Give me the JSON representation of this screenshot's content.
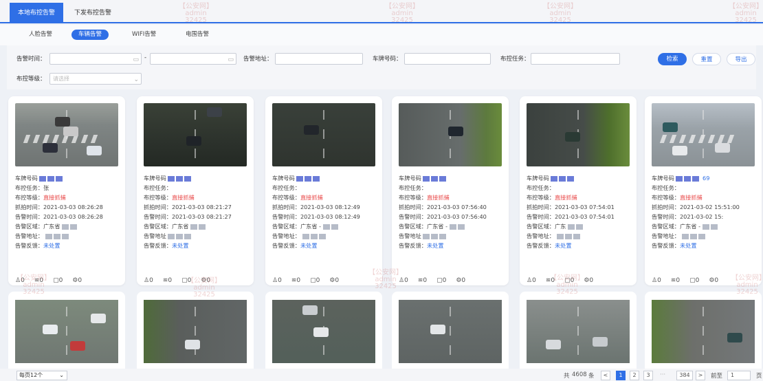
{
  "top_tabs": [
    "本地布控告警",
    "下发布控告警"
  ],
  "sub_tabs": [
    "人脸告警",
    "车辆告警",
    "WIFI告警",
    "电围告警"
  ],
  "filter": {
    "alarm_time_label": "告警时间：",
    "alarm_address_label": "告警地址：",
    "plate_label": "车牌号码：",
    "task_label": "布控任务：",
    "level_label": "布控等级：",
    "level_placeholder": "请选择",
    "search": "检索",
    "reset": "重置",
    "export": "导出"
  },
  "cards": [
    {
      "plate_label": "车牌号码",
      "task": "布控任务：张",
      "level_label": "布控等级：",
      "level": "直接抓捕",
      "capture": "抓拍时间：2021-03-03 08:26:28",
      "alarm": "告警时间：2021-03-03 08:26:28",
      "area": "告警区域：广东省",
      "addr": "告警地址：",
      "feedback_label": "告警反馈：",
      "feedback": "未处置"
    },
    {
      "plate_label": "车牌号码",
      "task": "布控任务：",
      "level_label": "布控等级：",
      "level": "直接抓捕",
      "capture": "抓拍时间：2021-03-03 08:21:27",
      "alarm": "告警时间：2021-03-03 08:21:27",
      "area": "告警区域：广东省",
      "addr": "告警地址",
      "feedback_label": "告警反馈：",
      "feedback": "未处置"
    },
    {
      "plate_label": "车牌号码",
      "task": "布控任务：",
      "level_label": "布控等级：",
      "level": "直接抓捕",
      "capture": "抓拍时间：2021-03-03 08:12:49",
      "alarm": "告警时间：2021-03-03 08:12:49",
      "area": "告警区域：广东省 -",
      "addr": "告警地址：",
      "feedback_label": "告警反馈：",
      "feedback": "未处置"
    },
    {
      "plate_label": "车牌号码",
      "task": "布控任务：",
      "level_label": "布控等级：",
      "level": "直接抓捕",
      "capture": "抓拍时间：2021-03-03 07:56:40",
      "alarm": "告警时间：2021-03-03 07:56:40",
      "area": "告警区域：广东省 -",
      "addr": "告警地址",
      "feedback_label": "告警反馈：",
      "feedback": "未处置"
    },
    {
      "plate_label": "车牌号码",
      "task": "布控任务：",
      "level_label": "布控等级：",
      "level": "直接抓捕",
      "capture": "抓拍时间：2021-03-03 07:54:01",
      "alarm": "告警时间：2021-03-03 07:54:01",
      "area": "告警区域：广东",
      "addr": "告警地址：",
      "feedback_label": "告警反馈：",
      "feedback": "未处置"
    },
    {
      "plate_label": "车牌号码",
      "task": "布控任务：",
      "level_label": "布控等级：",
      "level": "直接抓捕",
      "capture": "抓拍时间：2021-03-02 15:51:00",
      "alarm": "告警时间：2021-03-02 15:",
      "area": "告警区域：广东省 -",
      "addr": "告警地址：",
      "feedback_label": "告警反馈：",
      "feedback": "未处置"
    }
  ],
  "card6_plate_suffix": "69",
  "stats": [
    "0",
    "0",
    "0",
    "0"
  ],
  "pager": {
    "page_size": "每页12个",
    "total_prefix": "共",
    "total": "4608",
    "total_suffix": "条",
    "pages": [
      "1",
      "2",
      "3",
      "384"
    ],
    "ellipsis": "···",
    "goto_label": "前至",
    "goto_value": "1",
    "page_unit": "页"
  },
  "watermark": [
    "【公安网】",
    "admin",
    "32425"
  ]
}
